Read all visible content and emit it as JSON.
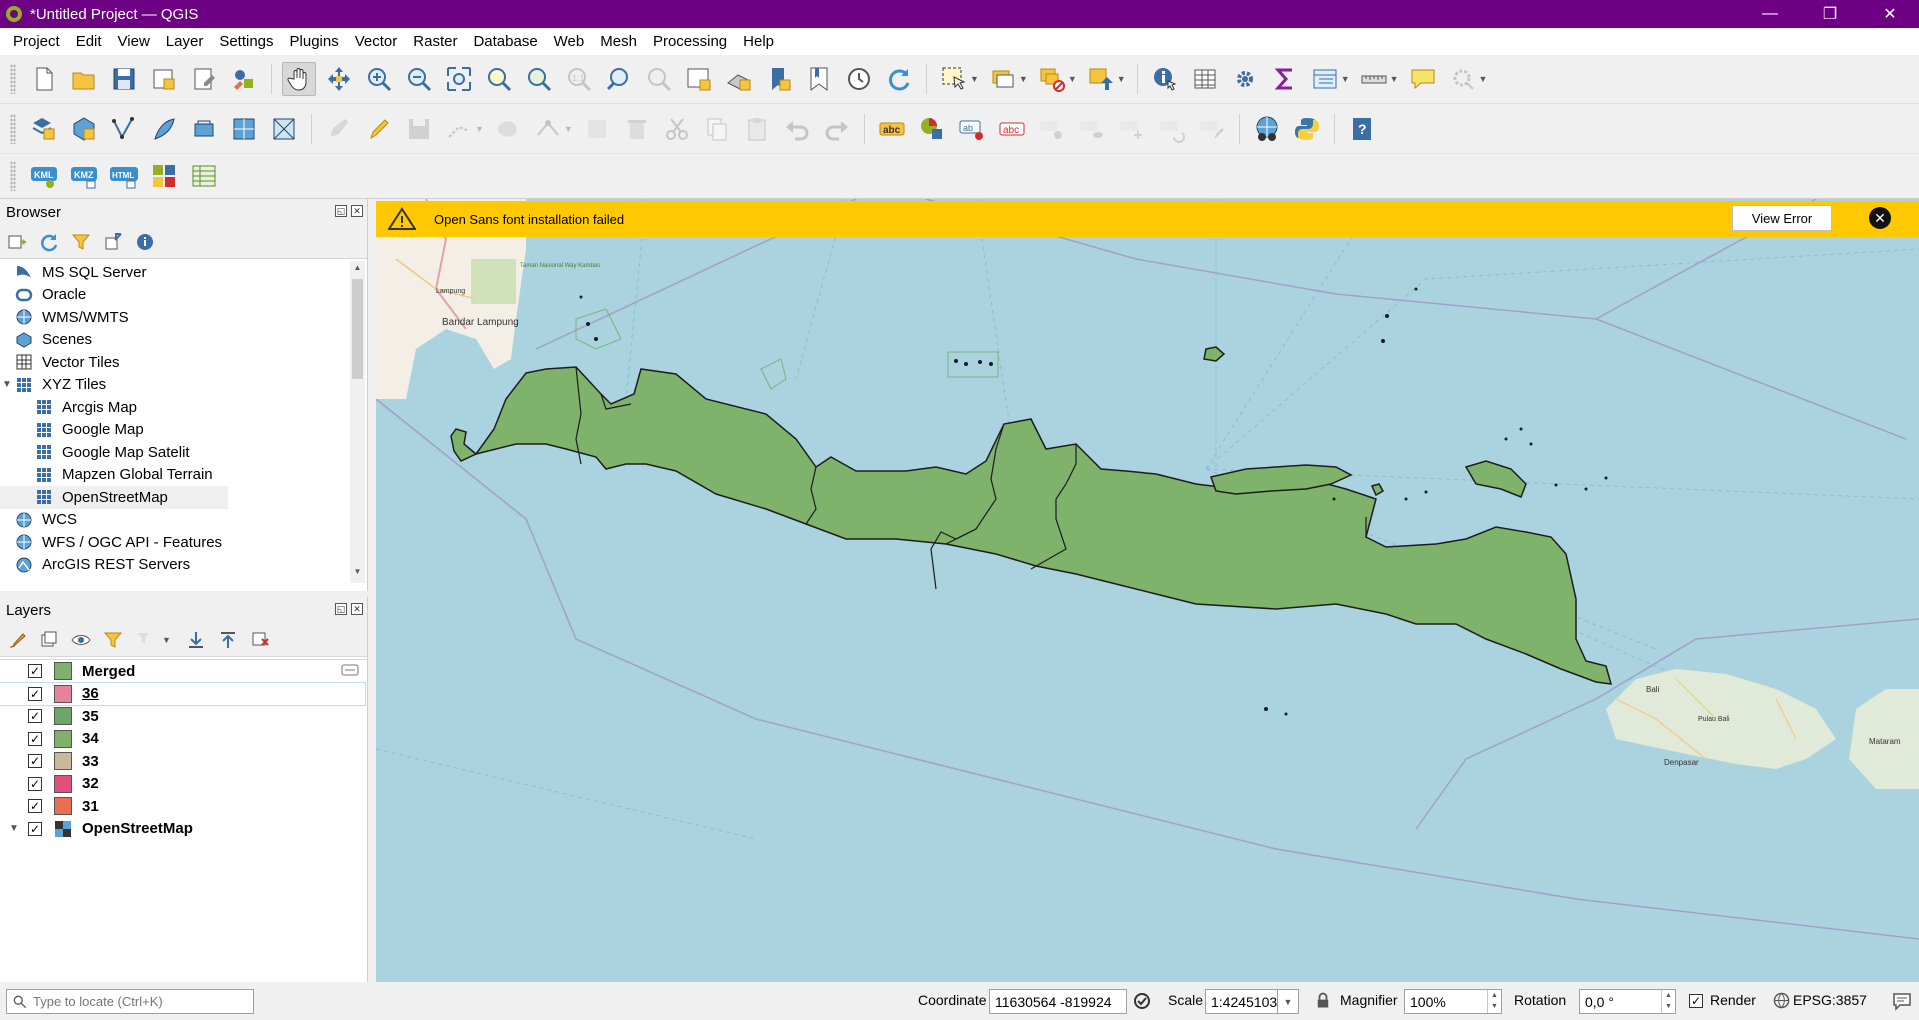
{
  "window": {
    "title": "*Untitled Project — QGIS",
    "controls": {
      "minimize": "—",
      "restore": "❐",
      "close": "✕"
    }
  },
  "menu": [
    "Project",
    "Edit",
    "View",
    "Layer",
    "Settings",
    "Plugins",
    "Vector",
    "Raster",
    "Database",
    "Web",
    "Mesh",
    "Processing",
    "Help"
  ],
  "toolbar3": {
    "kml_label": "KML",
    "kmz_label": "KMZ",
    "html_label": "HTML"
  },
  "toolbar2": {
    "abc": "abc",
    "ab": "ab"
  },
  "browser": {
    "title": "Browser",
    "items": [
      {
        "label": "MS SQL Server",
        "icon": "mssql-icon"
      },
      {
        "label": "Oracle",
        "icon": "oracle-icon"
      },
      {
        "label": "WMS/WMTS",
        "icon": "wms-icon"
      },
      {
        "label": "Scenes",
        "icon": "scenes-icon"
      },
      {
        "label": "Vector Tiles",
        "icon": "vector-tiles-icon"
      },
      {
        "label": "XYZ Tiles",
        "icon": "xyz-tiles-icon",
        "expanded": true
      },
      {
        "label": "Arcgis Map",
        "icon": "tile-grid-icon"
      },
      {
        "label": "Google Map",
        "icon": "tile-grid-icon"
      },
      {
        "label": "Google Map Satelit",
        "icon": "tile-grid-icon"
      },
      {
        "label": "Mapzen Global Terrain",
        "icon": "tile-grid-icon"
      },
      {
        "label": "OpenStreetMap",
        "icon": "tile-grid-icon",
        "selected": true
      },
      {
        "label": "WCS",
        "icon": "wcs-icon"
      },
      {
        "label": "WFS / OGC API - Features",
        "icon": "wfs-icon"
      },
      {
        "label": "ArcGIS REST Servers",
        "icon": "arcgis-rest-icon"
      }
    ]
  },
  "layers": {
    "title": "Layers",
    "items": [
      {
        "name": "Merged",
        "color": "#7fb26b",
        "checked": true
      },
      {
        "name": "36",
        "color": "#e8829a",
        "checked": true,
        "highlighted": true
      },
      {
        "name": "35",
        "color": "#6ea56a",
        "checked": true
      },
      {
        "name": "34",
        "color": "#7fb26b",
        "checked": true
      },
      {
        "name": "33",
        "color": "#c9b99a",
        "checked": true
      },
      {
        "name": "32",
        "color": "#e0507a",
        "checked": true
      },
      {
        "name": "31",
        "color": "#e8704f",
        "checked": true
      },
      {
        "name": "OpenStreetMap",
        "color": null,
        "checked": true,
        "group": true
      }
    ]
  },
  "message_bar": {
    "text": "Open Sans font installation failed",
    "button": "View Error"
  },
  "map": {
    "labels": [
      "Bandar Lampung",
      "Lampung",
      "Taman Nasional Way Kambas",
      "Denpasar",
      "Mataram",
      "Pulau Bali",
      "Bali"
    ],
    "land_color": "#7fb26b",
    "sea_color": "#aad3df"
  },
  "status": {
    "locator_placeholder": "Type to locate (Ctrl+K)",
    "coordinate_label": "Coordinate",
    "coordinate_value": "11630564  -819924",
    "scale_label": "Scale",
    "scale_value": "1:4245103",
    "magnifier_label": "Magnifier",
    "magnifier_value": "100%",
    "rotation_label": "Rotation",
    "rotation_value": "0,0 °",
    "render_label": "Render",
    "crs": "EPSG:3857"
  }
}
